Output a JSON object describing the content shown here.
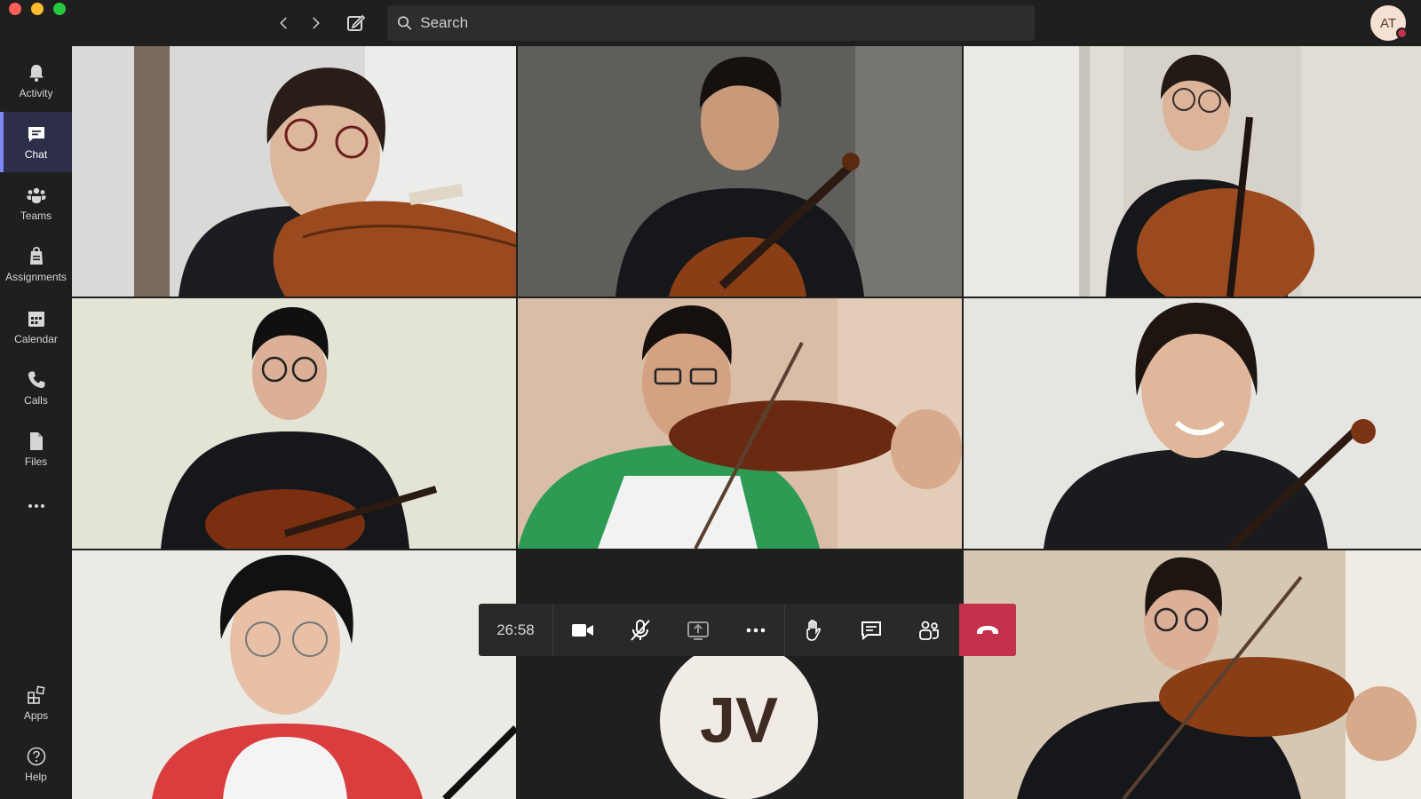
{
  "window": {
    "search_placeholder": "Search",
    "user_initials": "AT"
  },
  "sidebar": {
    "items": [
      {
        "label": "Activity",
        "icon": "bell-icon"
      },
      {
        "label": "Chat",
        "icon": "chat-icon",
        "active": true
      },
      {
        "label": "Teams",
        "icon": "teams-icon"
      },
      {
        "label": "Assignments",
        "icon": "assignments-icon"
      },
      {
        "label": "Calendar",
        "icon": "calendar-icon"
      },
      {
        "label": "Calls",
        "icon": "phone-icon"
      },
      {
        "label": "Files",
        "icon": "file-icon"
      }
    ],
    "more_icon": "more-icon",
    "bottom": [
      {
        "label": "Apps",
        "icon": "apps-icon"
      },
      {
        "label": "Help",
        "icon": "help-icon"
      }
    ]
  },
  "call": {
    "participant_initials": "JV",
    "timer": "26:58",
    "controls": [
      "camera-icon",
      "mic-off-icon",
      "share-screen-icon",
      "more-actions-icon",
      "raise-hand-icon",
      "chat-icon",
      "participants-icon",
      "hang-up-icon"
    ],
    "colors": {
      "hangup": "#c4314b",
      "accent": "#7f85f5"
    }
  }
}
